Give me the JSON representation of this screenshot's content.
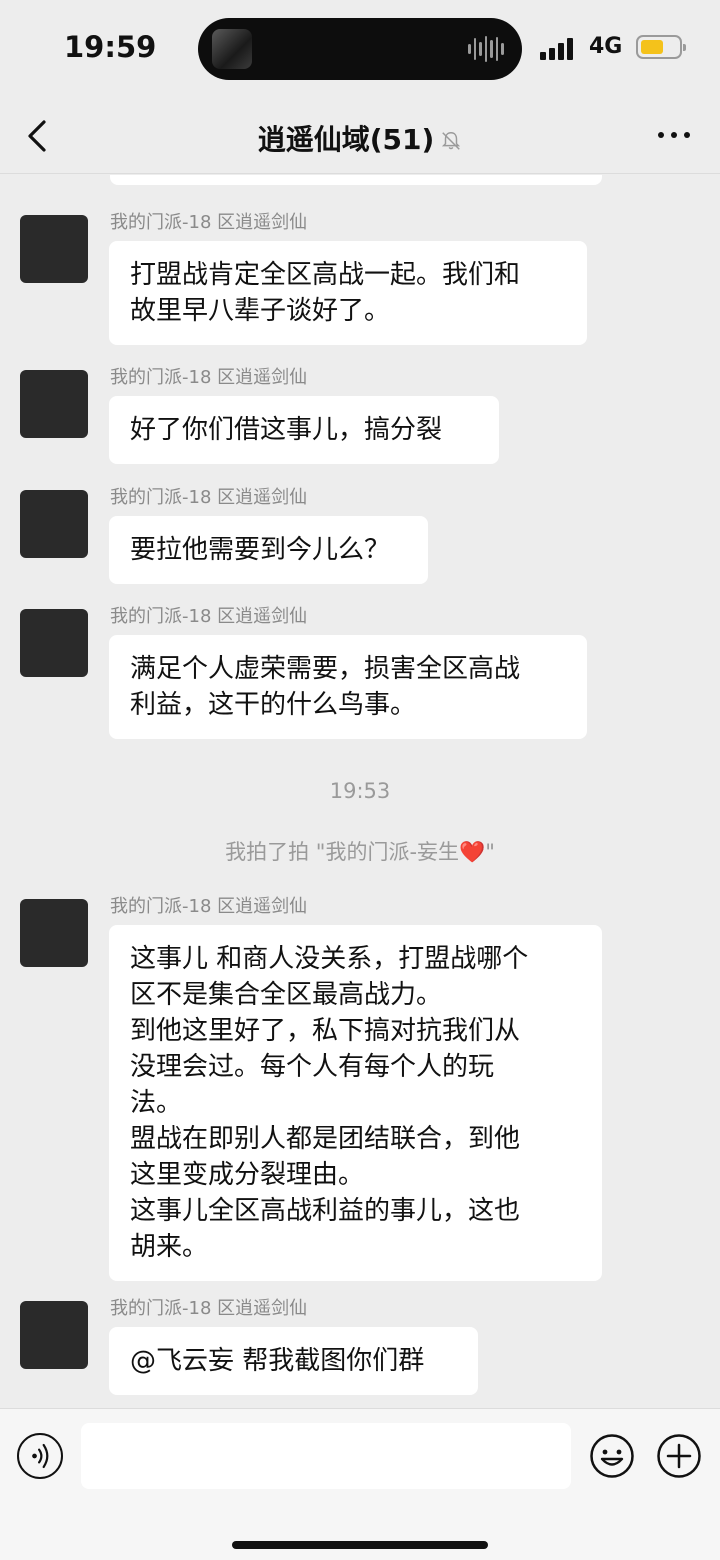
{
  "status_bar": {
    "time": "19:59",
    "network": "4G",
    "battery_level": 0.6,
    "battery_color": "#f4c21b"
  },
  "nav": {
    "title": "逍遥仙域(51)",
    "back_icon": "chevron-left-icon",
    "mute_icon": "bell-muted-icon",
    "more_icon": "more-dots-icon"
  },
  "messages": [
    {
      "sender": "我的门派-18 区逍遥剑仙",
      "text": "打盟战肯定全区高战一起。我们和\n故里早八辈子谈好了。"
    },
    {
      "sender": "我的门派-18 区逍遥剑仙",
      "text": "好了你们借这事儿，搞分裂"
    },
    {
      "sender": "我的门派-18 区逍遥剑仙",
      "text": "要拉他需要到今儿么？"
    },
    {
      "sender": "我的门派-18 区逍遥剑仙",
      "text": "满足个人虚荣需要，损害全区高战\n利益，这干的什么鸟事。"
    },
    {
      "sender": "我的门派-18 区逍遥剑仙",
      "text": "这事儿  和商人没关系，打盟战哪个\n区不是集合全区最高战力。\n到他这里好了，私下搞对抗我们从\n没理会过。每个人有每个人的玩\n法。\n盟战在即别人都是团结联合，到他\n这里变成分裂理由。\n这事儿全区高战利益的事儿，这也\n胡来。"
    },
    {
      "sender": "我的门派-18 区逍遥剑仙",
      "text": "@飞云妄 帮我截图你们群"
    }
  ],
  "timestamp": "19:53",
  "system_notice": {
    "prefix": "我拍了拍 \"我的门派-妄生",
    "heart": "❤️",
    "suffix": "\""
  },
  "input_bar": {
    "voice_icon": "voice-icon",
    "emoji_icon": "emoji-icon",
    "plus_icon": "plus-icon"
  },
  "colors": {
    "background": "#ededed",
    "bubble": "#ffffff",
    "meta_text": "#8a8a8a"
  }
}
